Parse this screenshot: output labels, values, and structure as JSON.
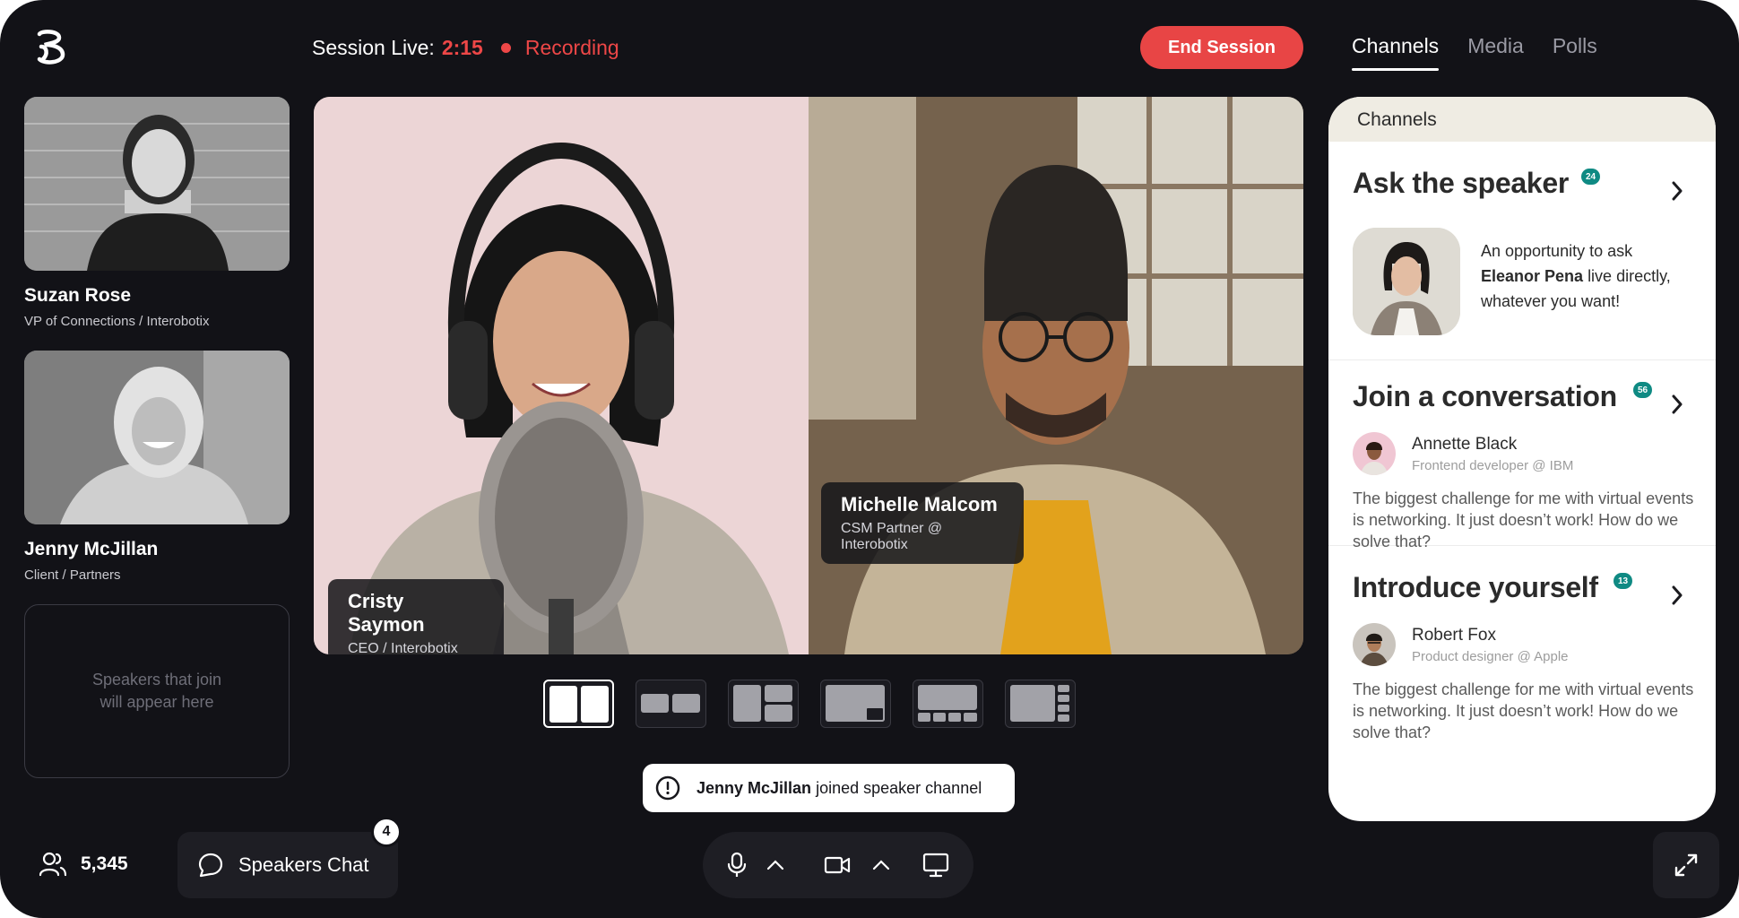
{
  "header": {
    "session_label": "Session Live:",
    "timer": "2:15",
    "recording": "Recording",
    "end_button": "End Session",
    "tabs": [
      {
        "label": "Channels",
        "active": true
      },
      {
        "label": "Media",
        "active": false
      },
      {
        "label": "Polls",
        "active": false
      }
    ]
  },
  "speakers": [
    {
      "name": "Suzan Rose",
      "role": "VP of Connections / Interobotix"
    },
    {
      "name": "Jenny McJillan",
      "role": "Client / Partners"
    }
  ],
  "placeholder": "Speakers that join will appear here",
  "main_video": {
    "left": {
      "name": "Cristy Saymon",
      "role": "CEO / Interobotix"
    },
    "right": {
      "name": "Michelle Malcom",
      "role": "CSM Partner @ Interobotix"
    }
  },
  "layout_options": [
    "two-up",
    "two-small",
    "grid-three",
    "picture-in-picture",
    "top-strip",
    "side-strip"
  ],
  "notification": {
    "name": "Jenny McJillan",
    "text": "joined speaker channel"
  },
  "bottom": {
    "attendee_count": "5,345",
    "chat_label": "Speakers Chat",
    "chat_badge": "4"
  },
  "panel": {
    "header": "Channels",
    "ask": {
      "title": "Ask the speaker",
      "count": "24",
      "text_pre": "An opportunity to ask",
      "text_name": "Eleanor Pena",
      "text_post": "live directly, whatever you want!"
    },
    "join": {
      "title": "Join a conversation",
      "count": "56",
      "person": "Annette Black",
      "role": "Frontend developer @ IBM",
      "quote": "The biggest challenge for me with virtual events is networking. It just doesn’t work! How do we solve that?"
    },
    "intro": {
      "title": "Introduce yourself",
      "count": "13",
      "person": "Robert Fox",
      "role": "Product designer @ Apple",
      "quote": "The biggest challenge for me with virtual events is networking. It just doesn’t work! How do we solve that?"
    }
  },
  "colors": {
    "background": "#121217",
    "accent_red": "#e84545",
    "teal_badge": "#0f8a83",
    "panel_header": "#efece3"
  },
  "icons": [
    "logo-icon",
    "users-icon",
    "chat-bubble-icon",
    "microphone-icon",
    "chevron-up-icon",
    "camera-icon",
    "monitor-icon",
    "expand-icon",
    "chevron-right-icon",
    "info-icon"
  ]
}
